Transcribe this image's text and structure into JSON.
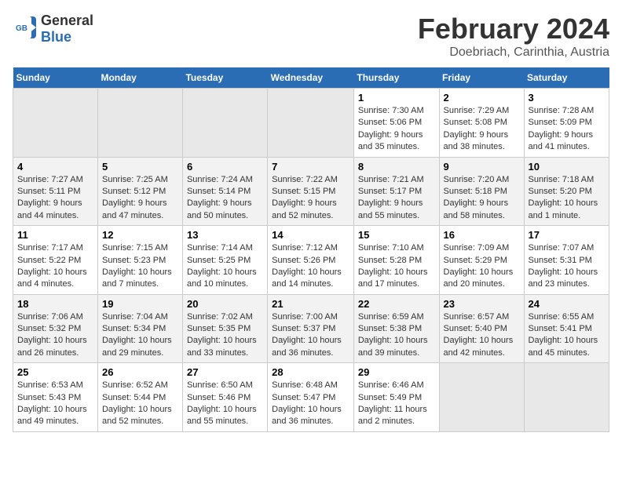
{
  "header": {
    "logo_general": "General",
    "logo_blue": "Blue",
    "title": "February 2024",
    "subtitle": "Doebriach, Carinthia, Austria"
  },
  "days_of_week": [
    "Sunday",
    "Monday",
    "Tuesday",
    "Wednesday",
    "Thursday",
    "Friday",
    "Saturday"
  ],
  "weeks": [
    [
      {
        "day": "",
        "info": ""
      },
      {
        "day": "",
        "info": ""
      },
      {
        "day": "",
        "info": ""
      },
      {
        "day": "",
        "info": ""
      },
      {
        "day": "1",
        "info": "Sunrise: 7:30 AM\nSunset: 5:06 PM\nDaylight: 9 hours and 35 minutes."
      },
      {
        "day": "2",
        "info": "Sunrise: 7:29 AM\nSunset: 5:08 PM\nDaylight: 9 hours and 38 minutes."
      },
      {
        "day": "3",
        "info": "Sunrise: 7:28 AM\nSunset: 5:09 PM\nDaylight: 9 hours and 41 minutes."
      }
    ],
    [
      {
        "day": "4",
        "info": "Sunrise: 7:27 AM\nSunset: 5:11 PM\nDaylight: 9 hours and 44 minutes."
      },
      {
        "day": "5",
        "info": "Sunrise: 7:25 AM\nSunset: 5:12 PM\nDaylight: 9 hours and 47 minutes."
      },
      {
        "day": "6",
        "info": "Sunrise: 7:24 AM\nSunset: 5:14 PM\nDaylight: 9 hours and 50 minutes."
      },
      {
        "day": "7",
        "info": "Sunrise: 7:22 AM\nSunset: 5:15 PM\nDaylight: 9 hours and 52 minutes."
      },
      {
        "day": "8",
        "info": "Sunrise: 7:21 AM\nSunset: 5:17 PM\nDaylight: 9 hours and 55 minutes."
      },
      {
        "day": "9",
        "info": "Sunrise: 7:20 AM\nSunset: 5:18 PM\nDaylight: 9 hours and 58 minutes."
      },
      {
        "day": "10",
        "info": "Sunrise: 7:18 AM\nSunset: 5:20 PM\nDaylight: 10 hours and 1 minute."
      }
    ],
    [
      {
        "day": "11",
        "info": "Sunrise: 7:17 AM\nSunset: 5:22 PM\nDaylight: 10 hours and 4 minutes."
      },
      {
        "day": "12",
        "info": "Sunrise: 7:15 AM\nSunset: 5:23 PM\nDaylight: 10 hours and 7 minutes."
      },
      {
        "day": "13",
        "info": "Sunrise: 7:14 AM\nSunset: 5:25 PM\nDaylight: 10 hours and 10 minutes."
      },
      {
        "day": "14",
        "info": "Sunrise: 7:12 AM\nSunset: 5:26 PM\nDaylight: 10 hours and 14 minutes."
      },
      {
        "day": "15",
        "info": "Sunrise: 7:10 AM\nSunset: 5:28 PM\nDaylight: 10 hours and 17 minutes."
      },
      {
        "day": "16",
        "info": "Sunrise: 7:09 AM\nSunset: 5:29 PM\nDaylight: 10 hours and 20 minutes."
      },
      {
        "day": "17",
        "info": "Sunrise: 7:07 AM\nSunset: 5:31 PM\nDaylight: 10 hours and 23 minutes."
      }
    ],
    [
      {
        "day": "18",
        "info": "Sunrise: 7:06 AM\nSunset: 5:32 PM\nDaylight: 10 hours and 26 minutes."
      },
      {
        "day": "19",
        "info": "Sunrise: 7:04 AM\nSunset: 5:34 PM\nDaylight: 10 hours and 29 minutes."
      },
      {
        "day": "20",
        "info": "Sunrise: 7:02 AM\nSunset: 5:35 PM\nDaylight: 10 hours and 33 minutes."
      },
      {
        "day": "21",
        "info": "Sunrise: 7:00 AM\nSunset: 5:37 PM\nDaylight: 10 hours and 36 minutes."
      },
      {
        "day": "22",
        "info": "Sunrise: 6:59 AM\nSunset: 5:38 PM\nDaylight: 10 hours and 39 minutes."
      },
      {
        "day": "23",
        "info": "Sunrise: 6:57 AM\nSunset: 5:40 PM\nDaylight: 10 hours and 42 minutes."
      },
      {
        "day": "24",
        "info": "Sunrise: 6:55 AM\nSunset: 5:41 PM\nDaylight: 10 hours and 45 minutes."
      }
    ],
    [
      {
        "day": "25",
        "info": "Sunrise: 6:53 AM\nSunset: 5:43 PM\nDaylight: 10 hours and 49 minutes."
      },
      {
        "day": "26",
        "info": "Sunrise: 6:52 AM\nSunset: 5:44 PM\nDaylight: 10 hours and 52 minutes."
      },
      {
        "day": "27",
        "info": "Sunrise: 6:50 AM\nSunset: 5:46 PM\nDaylight: 10 hours and 55 minutes."
      },
      {
        "day": "28",
        "info": "Sunrise: 6:48 AM\nSunset: 5:47 PM\nDaylight: 10 hours and 36 minutes."
      },
      {
        "day": "29",
        "info": "Sunrise: 6:46 AM\nSunset: 5:49 PM\nDaylight: 11 hours and 2 minutes."
      },
      {
        "day": "",
        "info": ""
      },
      {
        "day": "",
        "info": ""
      }
    ]
  ]
}
